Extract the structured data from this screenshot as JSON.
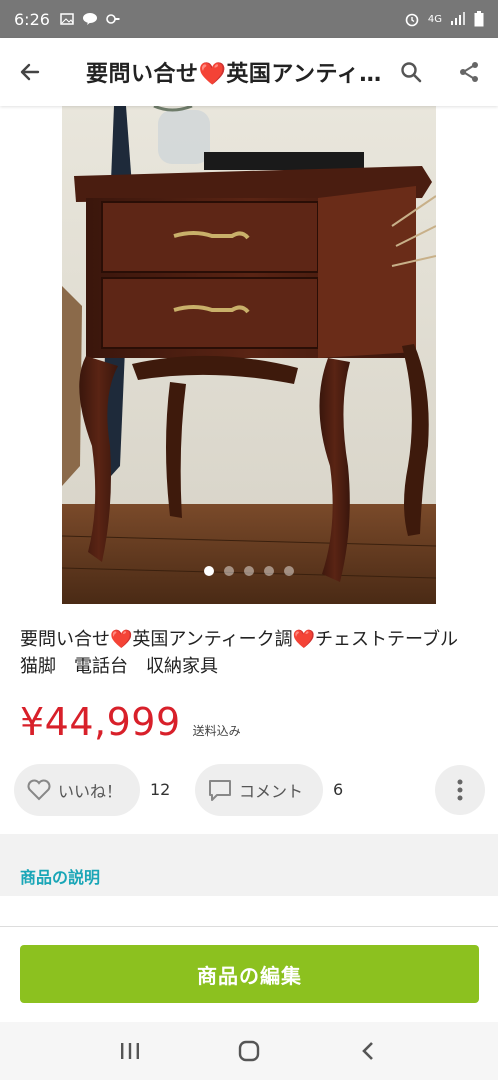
{
  "status_bar": {
    "time": "6:26",
    "network": "4G"
  },
  "header": {
    "title": "要問い合せ❤️英国アンティーク調❤️チェストテーブル　猫脚　電話台　収納家具"
  },
  "gallery": {
    "image_alt": "antique-chest-table-photo",
    "dot_count": 5,
    "active_index": 0
  },
  "item": {
    "title": "要問い合せ❤️英国アンティーク調❤️チェストテーブル　猫脚　電話台　収納家具",
    "price": "¥44,999",
    "shipping": "送料込み"
  },
  "actions": {
    "like_label": "いいね！",
    "like_count": "12",
    "comment_label": "コメント",
    "comment_count": "6"
  },
  "description": {
    "heading": "商品の説明"
  },
  "bottom": {
    "edit_label": "商品の編集"
  },
  "colors": {
    "price": "#d8202a",
    "accent_teal": "#1aa6b7",
    "edit_button": "#8cc11f"
  }
}
